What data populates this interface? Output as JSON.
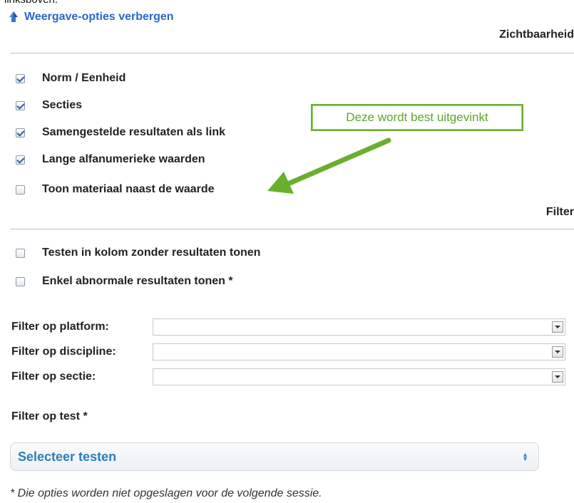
{
  "top_fragment": "linksboven.",
  "hide_options_link": "Weergave-opties verbergen",
  "visibility": {
    "heading": "Zichtbaarheid",
    "options": [
      {
        "label": "Norm / Eenheid",
        "checked": true
      },
      {
        "label": "Secties",
        "checked": true
      },
      {
        "label": "Samengestelde resultaten als link",
        "checked": true
      },
      {
        "label": "Lange alfanumerieke waarden",
        "checked": true
      },
      {
        "label": "Toon materiaal naast de waarde",
        "checked": false
      }
    ]
  },
  "callout": {
    "text": "Deze wordt best uitgevinkt",
    "color": "#6aae2f"
  },
  "filter": {
    "heading": "Filter",
    "options": [
      {
        "label": "Testen in kolom zonder resultaten tonen",
        "checked": false
      },
      {
        "label": "Enkel abnormale resultaten tonen *",
        "checked": false
      }
    ],
    "selects": [
      {
        "label": "Filter op platform:",
        "value": ""
      },
      {
        "label": "Filter op discipline:",
        "value": ""
      },
      {
        "label": "Filter op sectie:",
        "value": ""
      }
    ],
    "test_label": "Filter op test *",
    "test_select": "Selecteer testen"
  },
  "footnote": "* Die opties worden niet opgeslagen voor de volgende sessie.",
  "colors": {
    "link": "#2b66c9",
    "accent_green": "#6aae2f",
    "select_text": "#2a7fb8"
  }
}
